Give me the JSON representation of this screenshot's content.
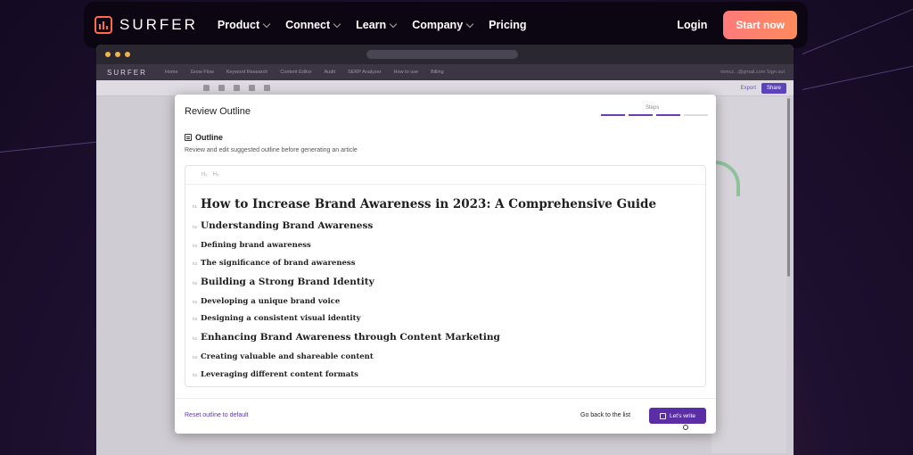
{
  "nav": {
    "logo": "SURFER",
    "items": [
      {
        "label": "Product",
        "dropdown": true
      },
      {
        "label": "Connect",
        "dropdown": true
      },
      {
        "label": "Learn",
        "dropdown": true
      },
      {
        "label": "Company",
        "dropdown": true
      },
      {
        "label": "Pricing",
        "dropdown": false
      }
    ],
    "login": "Login",
    "cta": "Start now"
  },
  "app": {
    "logo": "SURFER",
    "nav_items": [
      "Home",
      "Grow Flow",
      "Keyword Research",
      "Content Editor",
      "Audit",
      "SERP Analyzer",
      "How to use",
      "Billing"
    ],
    "user": "tomcz...@gmail.com  Sign out",
    "export": "Export",
    "share": "Share"
  },
  "modal": {
    "title": "Review Outline",
    "steps_label": "Steps",
    "steps": [
      true,
      true,
      true,
      false
    ],
    "outline_label": "Outline",
    "outline_desc": "Review and edit suggested outline before generating an article",
    "toolbar": [
      "H₂",
      "H₃"
    ],
    "headings": [
      {
        "level": "h1",
        "text": "How to Increase Brand Awareness in 2023: A Comprehensive Guide"
      },
      {
        "level": "h2",
        "text": "Understanding Brand Awareness"
      },
      {
        "level": "h3",
        "text": "Defining brand awareness"
      },
      {
        "level": "h3",
        "text": "The significance of brand awareness"
      },
      {
        "level": "h2",
        "text": "Building a Strong Brand Identity"
      },
      {
        "level": "h3",
        "text": "Developing a unique brand voice"
      },
      {
        "level": "h3",
        "text": "Designing a consistent visual identity"
      },
      {
        "level": "h2",
        "text": "Enhancing Brand Awareness through Content Marketing"
      },
      {
        "level": "h3",
        "text": "Creating valuable and shareable content"
      },
      {
        "level": "h3",
        "text": "Leveraging different content formats"
      }
    ],
    "reset": "Reset outline to default",
    "go_back": "Go back to the list",
    "write": "Let's write"
  },
  "colors": {
    "accent": "#5b2ea6",
    "cta": "#ff7a7a"
  }
}
